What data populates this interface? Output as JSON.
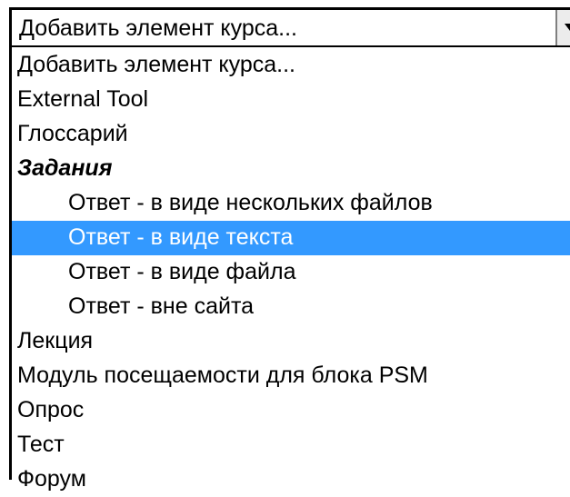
{
  "select": {
    "current_value": "Добавить элемент курса...",
    "dropdown_icon": "chevron-down-icon"
  },
  "options": [
    {
      "label": "Добавить элемент курса...",
      "kind": "option",
      "selected": false
    },
    {
      "label": "External Tool",
      "kind": "option",
      "selected": false
    },
    {
      "label": "Глоссарий",
      "kind": "option",
      "selected": false
    },
    {
      "label": "Задания",
      "kind": "group",
      "selected": false
    },
    {
      "label": "Ответ - в виде нескольких файлов",
      "kind": "child",
      "selected": false
    },
    {
      "label": "Ответ - в виде текста",
      "kind": "child",
      "selected": true
    },
    {
      "label": "Ответ - в виде файла",
      "kind": "child",
      "selected": false
    },
    {
      "label": "Ответ - вне сайта",
      "kind": "child",
      "selected": false
    },
    {
      "label": "Лекция",
      "kind": "option",
      "selected": false
    },
    {
      "label": "Модуль посещаемости для блока PSM",
      "kind": "option",
      "selected": false
    },
    {
      "label": "Опрос",
      "kind": "option",
      "selected": false
    },
    {
      "label": "Тест",
      "kind": "option",
      "selected": false
    },
    {
      "label": "Форум",
      "kind": "option",
      "selected": false
    }
  ],
  "colors": {
    "selected_background": "#3399ff",
    "selected_text": "#ffffff"
  }
}
